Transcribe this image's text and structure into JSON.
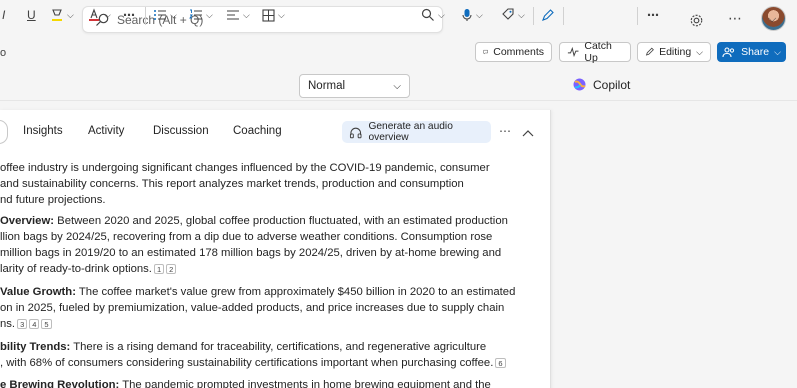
{
  "search": {
    "placeholder": "Search (Alt + Q)"
  },
  "topbar": {
    "settings_icon": "gear-icon",
    "more_icon": "ellipsis-icon",
    "left_fragment": "o"
  },
  "actions": {
    "comments": "Comments",
    "catchup": "Catch Up",
    "editing": "Editing",
    "share": "Share"
  },
  "ribbon": {
    "style_value": "Normal",
    "copilot": "Copilot",
    "underline": "U",
    "italic": "I"
  },
  "panel": {
    "tabs": [
      "Insights",
      "Activity",
      "Discussion",
      "Coaching"
    ],
    "audio_button": "Generate an audio overview"
  },
  "document": {
    "lines": [
      {
        "pre": "",
        "bold": "",
        "text": "offee industry is undergoing significant changes influenced by the COVID-19 pandemic, consumer",
        "cites": []
      },
      {
        "pre": "",
        "bold": "",
        "text": "and sustainability concerns. This report analyzes market trends, production and consumption",
        "cites": []
      },
      {
        "pre": "",
        "bold": "",
        "text": "nd future projections.",
        "cites": []
      },
      {
        "pre": "",
        "bold": "Overview:",
        "text": " Between 2020 and 2025, global coffee production fluctuated, with an estimated production",
        "cites": []
      },
      {
        "pre": "",
        "bold": "",
        "text": "llion bags by 2024/25, recovering from a dip due to adverse weather conditions. Consumption rose",
        "cites": []
      },
      {
        "pre": "",
        "bold": "",
        "text": "million bags in 2019/20 to an estimated 178 million bags by 2024/25, driven by at-home brewing and",
        "cites": []
      },
      {
        "pre": "",
        "bold": "",
        "text": "larity of ready-to-drink options.",
        "cites": [
          "1",
          "2"
        ]
      },
      {
        "pre": "",
        "bold": "Value Growth:",
        "text": " The coffee market's value grew from approximately $450 billion in 2020 to an estimated",
        "cites": []
      },
      {
        "pre": "",
        "bold": "",
        "text": "on in 2025, fueled by premiumization, value-added products, and price increases due to supply chain",
        "cites": []
      },
      {
        "pre": "",
        "bold": "",
        "text": "ns.",
        "cites": [
          "3",
          "4",
          "5"
        ]
      },
      {
        "pre": "",
        "bold": "bility Trends:",
        "text": " There is a rising demand for traceability, certifications, and regenerative agriculture",
        "cites": []
      },
      {
        "pre": "",
        "bold": "",
        "text": ", with 68% of consumers considering sustainability certifications important when purchasing coffee.",
        "cites": [
          "6"
        ]
      },
      {
        "pre": "",
        "bold": "e Brewing Revolution:",
        "text": " The pandemic prompted investments in home brewing equipment and the",
        "cites": []
      }
    ]
  }
}
